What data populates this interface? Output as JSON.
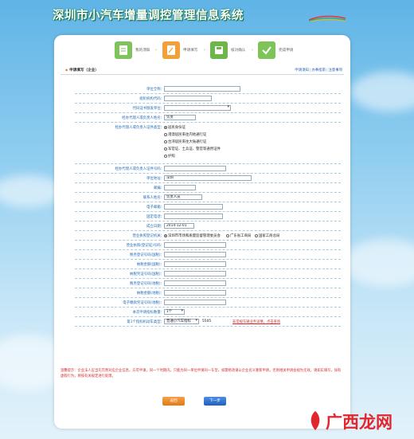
{
  "header": {
    "title": "深圳市小汽车增量调控管理信息系统"
  },
  "steps": [
    {
      "label": "我的须知",
      "color": "#7ec45a",
      "icon": "document-icon"
    },
    {
      "label": "申请填写",
      "color": "#f2a13a",
      "icon": "edit-icon"
    },
    {
      "label": "核对确认",
      "color": "#6cb64a",
      "icon": "save-icon"
    },
    {
      "label": "完成申请",
      "color": "#7ec45a",
      "icon": "check-icon"
    }
  ],
  "section": {
    "title": "申请填写（企业）",
    "links": [
      "申请须知",
      "办事指南",
      "注意事项"
    ]
  },
  "form": {
    "fields": {
      "company_name": {
        "label": "单位全称：",
        "value": ""
      },
      "org_code": {
        "label": "组织机构代码：",
        "value": ""
      },
      "id_issuer": {
        "label": "代码证书颁发单位：",
        "value": ""
      },
      "agent_name": {
        "label": "经办代理人或负责人姓名：",
        "value": ""
      },
      "agent_name_value": "负责",
      "id_type": {
        "label": "经办代理人或负责人证件类型："
      },
      "id_types": [
        "居民身份证",
        "港澳居民来往内地通行证",
        "台湾居民来往大陆通行证",
        "军官证、士兵证、警官等通用证件",
        "护照"
      ],
      "id_number": {
        "label": "经办代理人或负责人证件号码：",
        "value": ""
      },
      "address": {
        "label": "单位地址：",
        "value": "深圳"
      },
      "postcode": {
        "label": "邮编：",
        "value": ""
      },
      "contact": {
        "label": "联系人姓名：",
        "value": "负责人员"
      },
      "email": {
        "label": "电子邮箱：",
        "value": ""
      },
      "phone": {
        "label": "固定电话：",
        "value": ""
      },
      "reg_date": {
        "label": "成立日期：",
        "value": "2014-12-01"
      },
      "reg_authority": {
        "label": "营业执照登记机关："
      },
      "authorities": [
        "深圳市市场和质量监督管理委员会",
        "广东省工商局",
        "国家工商总局"
      ],
      "license_no": {
        "label": "营业执照(登记证)号码：",
        "value": ""
      },
      "tax_no1": {
        "label": "税务登记号码(国税)：",
        "value": ""
      },
      "tax_amount1": {
        "label": "纳税金额(国税)：",
        "value": ""
      },
      "tax_record1": {
        "label": "纳税凭证号码(国税)：",
        "value": ""
      },
      "tax_no2": {
        "label": "税务登记号码(地税)：",
        "value": ""
      },
      "tax_amount2": {
        "label": "纳税金额(地税)：",
        "value": ""
      },
      "tax_record2": {
        "label": "电子缴款凭证号码(地税)：",
        "value": ""
      },
      "apply_count": {
        "label": "本次申请指标数量：",
        "value": "1个"
      },
      "car_type": {
        "label": "第1个指标机动车类型：",
        "value": "普通小汽车指标",
        "extra": "5505",
        "link": "非常规车辆业务详情，点击查询"
      }
    }
  },
  "note": "温馨提示：企业法人应当先完善对应企业信息，方可申请，同一个时期内，只能为同一单位申请同一车型，如需修改请以企业名义重新申请，否则相关申请会视为无效。请如实填写，如有虚假行为，将按有关规定进行处理。",
  "buttons": {
    "prev": "返回",
    "next": "下一步"
  },
  "watermark": {
    "text": "广西龙网"
  }
}
